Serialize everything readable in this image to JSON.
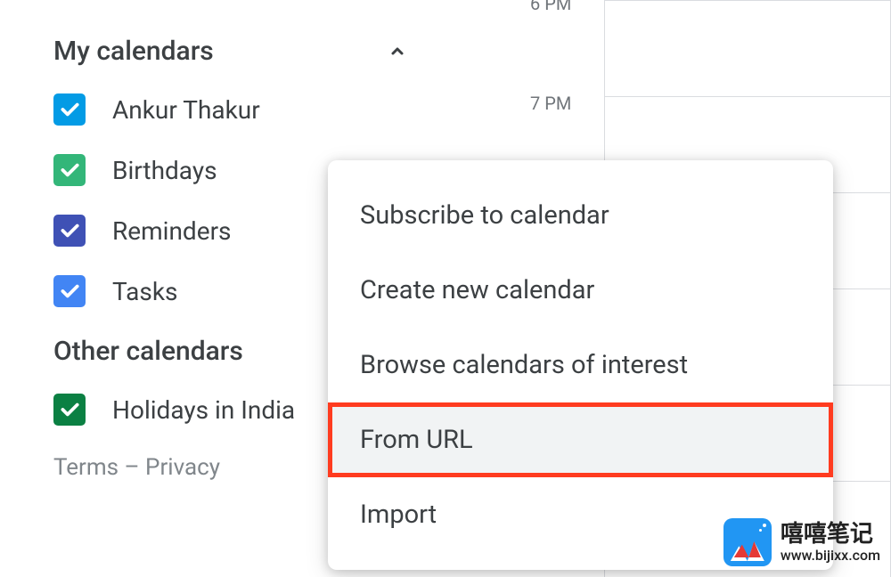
{
  "time_slots": [
    "6 PM",
    "7 PM"
  ],
  "sections": {
    "my_calendars": {
      "title": "My calendars",
      "items": [
        {
          "label": "Ankur Thakur",
          "color": "#039be5",
          "checked": true
        },
        {
          "label": "Birthdays",
          "color": "#33b679",
          "checked": true
        },
        {
          "label": "Reminders",
          "color": "#3f51b5",
          "checked": true
        },
        {
          "label": "Tasks",
          "color": "#4285f4",
          "checked": true
        }
      ]
    },
    "other_calendars": {
      "title": "Other calendars",
      "items": [
        {
          "label": "Holidays in India",
          "color": "#0b8043",
          "checked": true
        }
      ]
    }
  },
  "footer": {
    "terms": "Terms",
    "separator": " – ",
    "privacy": "Privacy"
  },
  "menu": {
    "items": [
      {
        "label": "Subscribe to calendar",
        "highlighted": false
      },
      {
        "label": "Create new calendar",
        "highlighted": false
      },
      {
        "label": "Browse calendars of interest",
        "highlighted": false
      },
      {
        "label": "From URL",
        "highlighted": true
      },
      {
        "label": "Import",
        "highlighted": false
      }
    ]
  },
  "watermark": {
    "title": "嘻嘻笔记",
    "url": "www.bijixx.com"
  }
}
